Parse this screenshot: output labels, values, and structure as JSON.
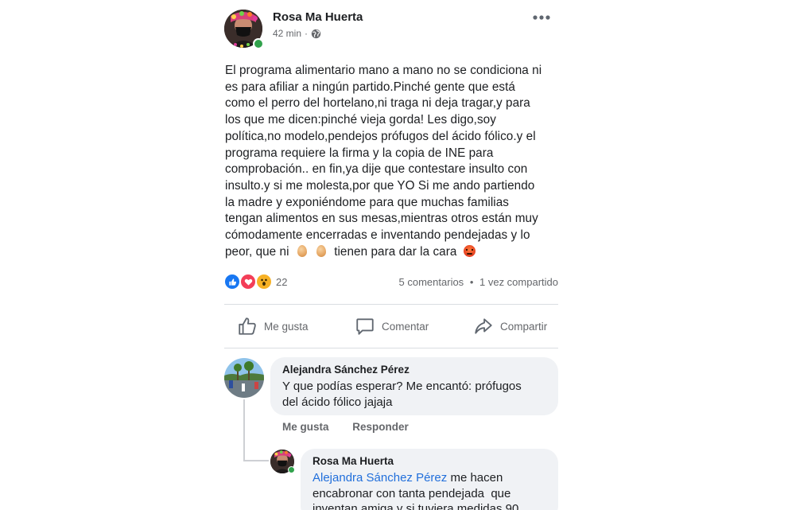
{
  "post": {
    "author": "Rosa Ma Huerta",
    "time": "42 min",
    "separator": "·",
    "privacy_icon": "globe-icon",
    "more_icon": "more-horizontal-icon",
    "text_lines": [
      "El programa alimentario mano a mano no se condiciona ni",
      "es para afiliar a ningún partido.Pinché gente que está",
      "como el perro del hortelano,ni traga ni deja tragar,y para",
      "los que me dicen:pinché vieja gorda! Les digo,soy",
      "política,no modelo,pendejos prófugos del ácido fólico.y el",
      "programa requiere la firma y la copia de INE para",
      "comprobación.. en fin,ya dije que contestare insulto con",
      "insulto.y si me molesta,por que YO Si me ando partiendo",
      "la madre y exponiéndome para que muchas familias",
      "tengan alimentos en sus mesas,mientras otros están muy",
      "cómodamente encerradas e inventando pendejadas y lo"
    ],
    "last_line_start": "peor, que ni",
    "last_line_end": "tienen para dar la cara",
    "emoji_icons": [
      "egg-emoji-icon",
      "egg-emoji-icon",
      "angry-face-icon"
    ]
  },
  "stats": {
    "reaction_icons": [
      "like-reaction-icon",
      "love-reaction-icon",
      "wow-reaction-icon"
    ],
    "reaction_count": "22",
    "comments": "5 comentarios",
    "dot": "•",
    "shares": "1 vez compartido"
  },
  "actions": {
    "like": "Me gusta",
    "comment": "Comentar",
    "share": "Compartir"
  },
  "comments": [
    {
      "author": "Alejandra Sánchez Pérez",
      "text_lines": [
        "Y que podías esperar? Me encantó: prófugos",
        "del ácido fólico jajaja"
      ],
      "like_label": "Me gusta",
      "reply_label": "Responder"
    },
    {
      "author": "Rosa Ma Huerta",
      "mention": "Alejandra Sánchez Pérez",
      "first_line_rest": " me hacen",
      "text_lines": [
        "encabronar con tanta pendejada  que",
        "inventan amiga,y si tuviera medidas 90"
      ]
    }
  ],
  "colors": {
    "text": "#1c1e21",
    "secondary": "#65676b",
    "link": "#216fdb",
    "bubble": "#f0f2f5",
    "online": "#31a24c",
    "like_blue": "#1877f2",
    "love_red": "#f33e58",
    "wow_yellow": "#f7b125"
  }
}
